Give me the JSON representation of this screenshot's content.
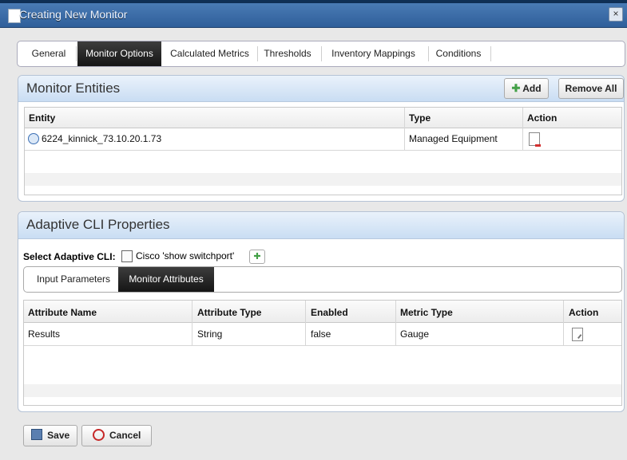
{
  "window": {
    "title": "Creating New Monitor",
    "close": "×"
  },
  "tabs": [
    {
      "label": "General"
    },
    {
      "label": "Monitor Options",
      "active": true
    },
    {
      "label": "Calculated Metrics"
    },
    {
      "label": "Thresholds"
    },
    {
      "label": "Inventory Mappings"
    },
    {
      "label": "Conditions"
    }
  ],
  "monitor_entities": {
    "title": "Monitor Entities",
    "add_label": "Add",
    "remove_all_label": "Remove All",
    "columns": [
      "Entity",
      "Type",
      "Action"
    ],
    "rows": [
      {
        "entity": "6224_kinnick_73.10.20.1.73",
        "type": "Managed Equipment"
      }
    ]
  },
  "adaptive_cli": {
    "title": "Adaptive CLI Properties",
    "select_label": "Select Adaptive CLI:",
    "selected_value": "Cisco 'show switchport'",
    "subtabs": [
      {
        "label": "Input Parameters"
      },
      {
        "label": "Monitor Attributes",
        "active": true
      }
    ],
    "columns": [
      "Attribute Name",
      "Attribute Type",
      "Enabled",
      "Metric Type",
      "Action"
    ],
    "rows": [
      {
        "name": "Results",
        "type": "String",
        "enabled": "false",
        "metric": "Gauge"
      }
    ]
  },
  "footer": {
    "save_label": "Save",
    "cancel_label": "Cancel"
  },
  "colors": {
    "title_bar": "#3a6aa5",
    "panel_header": "#d6e5f5",
    "active_tab": "#222222",
    "add_icon": "#4caf50",
    "cancel_icon": "#c62828"
  }
}
